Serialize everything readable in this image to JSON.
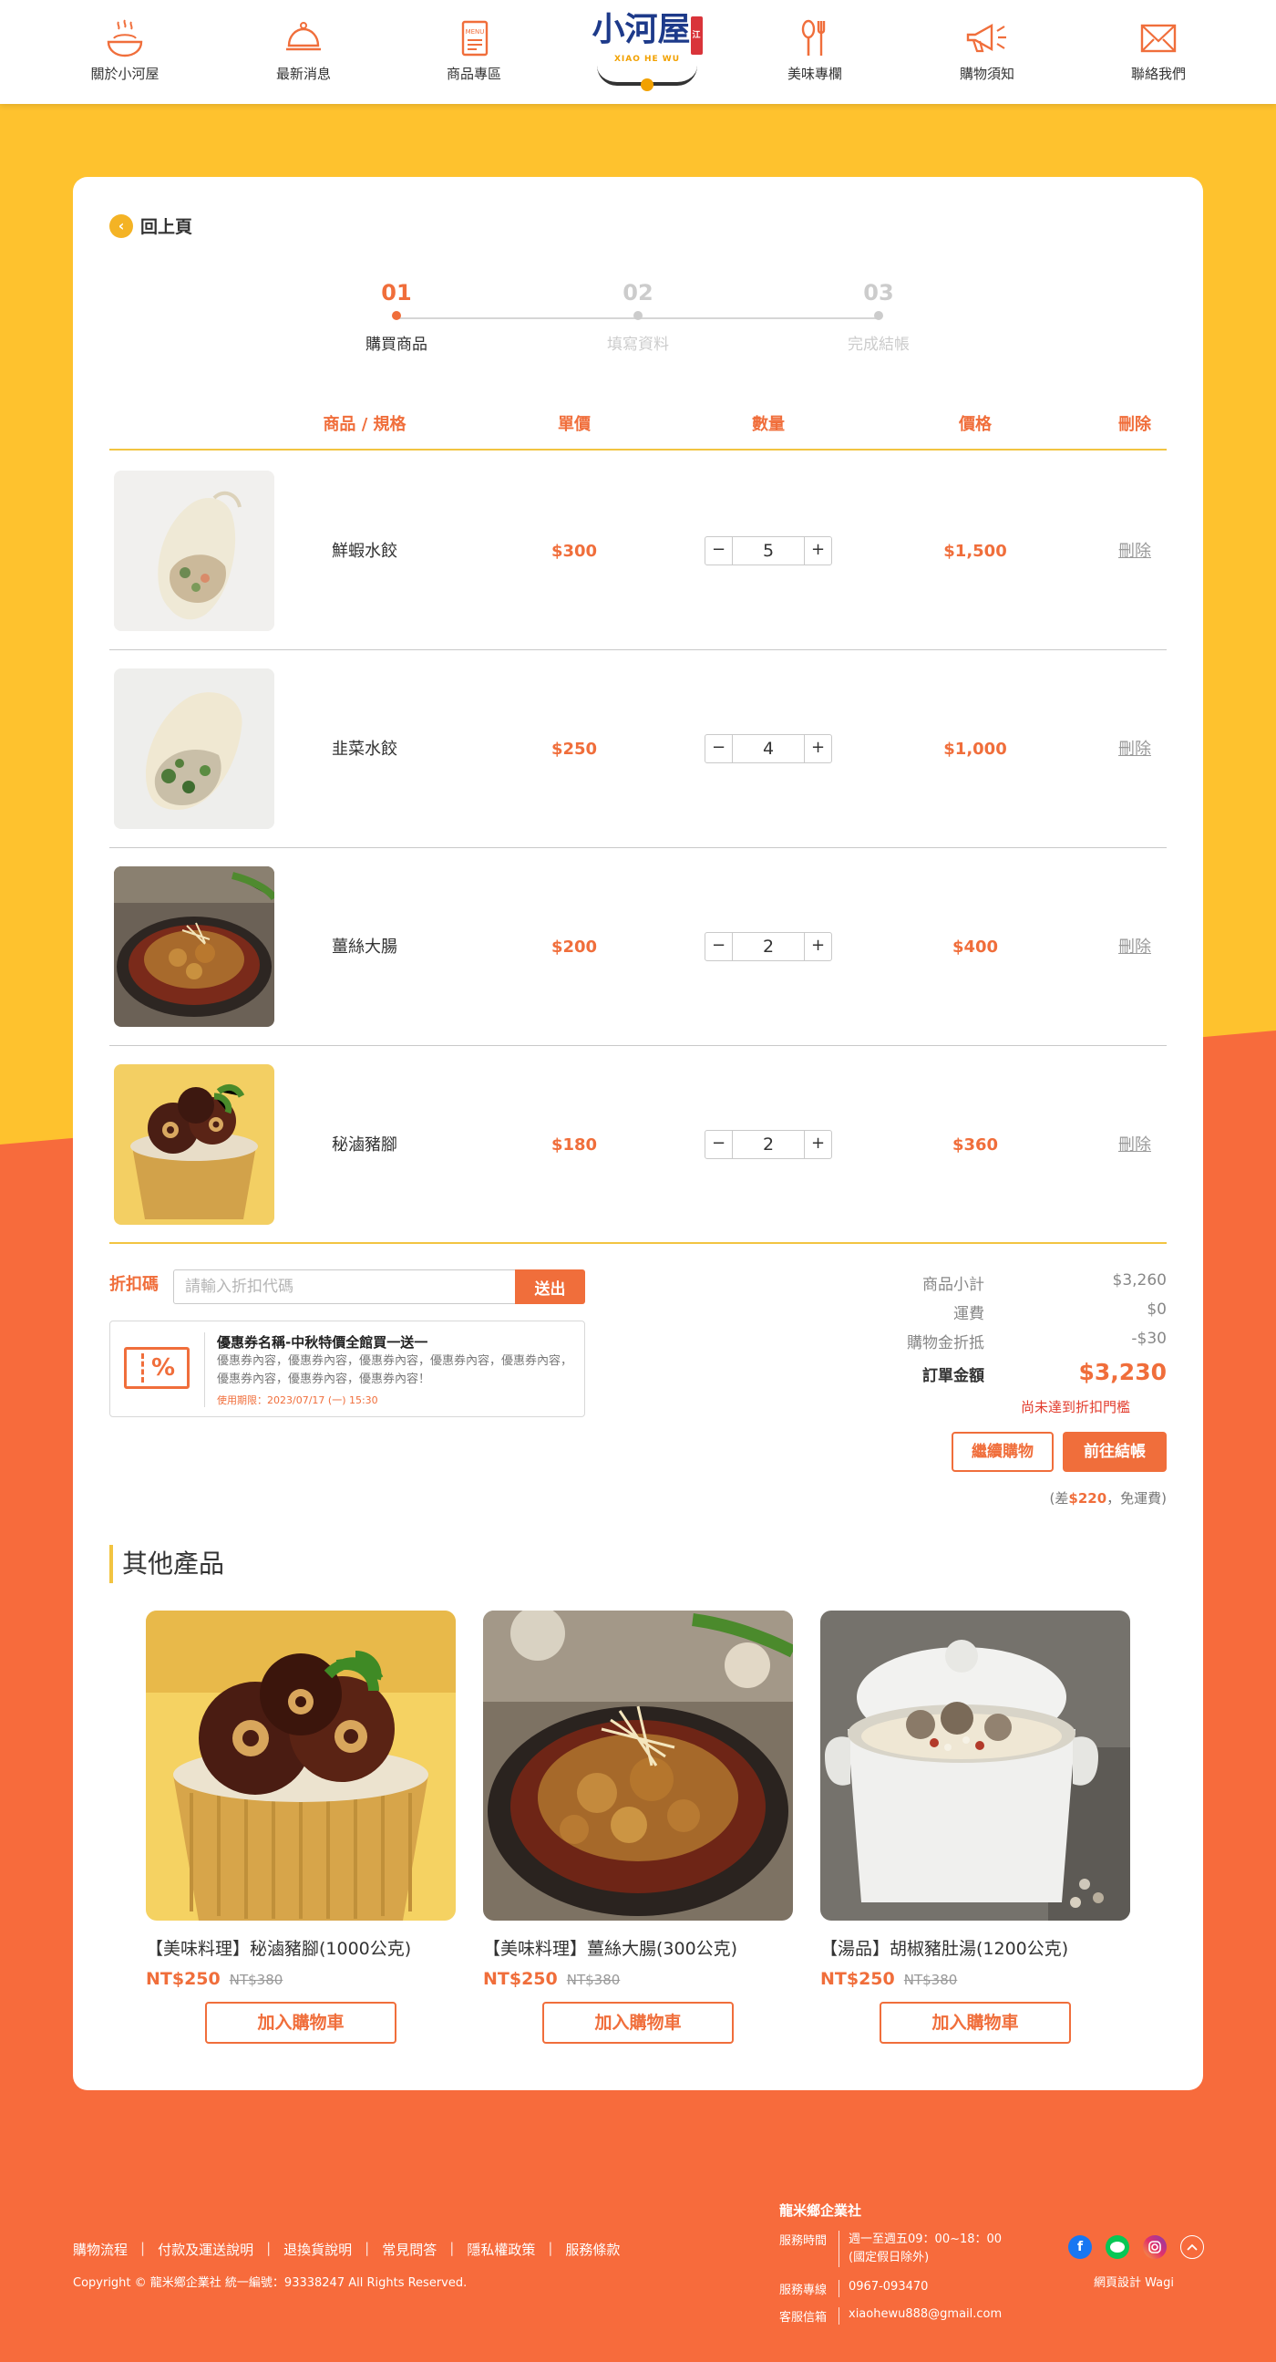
{
  "nav": {
    "left": [
      "關於小河屋",
      "最新消息",
      "商品專區"
    ],
    "right": [
      "美味專欄",
      "購物須知",
      "聯絡我們"
    ]
  },
  "logo": {
    "main": "小河屋",
    "sub": "XIAO HE WU",
    "badge": "江"
  },
  "back_label": "回上頁",
  "steps": [
    {
      "num": "01",
      "label": "購買商品"
    },
    {
      "num": "02",
      "label": "填寫資料"
    },
    {
      "num": "03",
      "label": "完成結帳"
    }
  ],
  "table_headers": {
    "product": "商品 / 規格",
    "unit": "單價",
    "qty": "數量",
    "price": "價格",
    "delete": "刪除"
  },
  "cart": [
    {
      "name": "鮮蝦水餃",
      "unit": "$300",
      "qty": "5",
      "total": "$1,500",
      "delete": "刪除"
    },
    {
      "name": "韭菜水餃",
      "unit": "$250",
      "qty": "4",
      "total": "$1,000",
      "delete": "刪除"
    },
    {
      "name": "薑絲大腸",
      "unit": "$200",
      "qty": "2",
      "total": "$400",
      "delete": "刪除"
    },
    {
      "name": "秘滷豬腳",
      "unit": "$180",
      "qty": "2",
      "total": "$360",
      "delete": "刪除"
    }
  ],
  "qty_minus": "−",
  "qty_plus": "+",
  "coupon": {
    "label": "折扣碼",
    "placeholder": "請輸入折扣代碼",
    "submit": "送出",
    "icon_text": "%",
    "title": "優惠券名稱-中秋特價全館買一送一",
    "desc": "優惠券內容，優惠券內容，優惠券內容，優惠券內容，優惠券內容，優惠券內容，優惠券內容，優惠券內容！",
    "expiry": "使用期限：2023/07/17 (一) 15:30"
  },
  "summary": {
    "subtotal_label": "商品小計",
    "subtotal": "$3,260",
    "shipping_label": "運費",
    "shipping": "$0",
    "discount_label": "購物金折抵",
    "discount": "-$30",
    "total_label": "訂單金額",
    "total": "$3,230",
    "threshold": "尚未達到折扣門檻",
    "continue": "繼續購物",
    "checkout": "前往結帳",
    "freeship_pre": "(差",
    "freeship_amount": "$220",
    "freeship_post": "，免運費)"
  },
  "other": {
    "title": "其他產品",
    "items": [
      {
        "name": "【美味料理】秘滷豬腳(1000公克)",
        "price": "NT$250",
        "old": "NT$380",
        "button": "加入購物車"
      },
      {
        "name": "【美味料理】薑絲大腸(300公克)",
        "price": "NT$250",
        "old": "NT$380",
        "button": "加入購物車"
      },
      {
        "name": "【湯品】胡椒豬肚湯(1200公克)",
        "price": "NT$250",
        "old": "NT$380",
        "button": "加入購物車"
      }
    ]
  },
  "footer": {
    "links": [
      "購物流程",
      "付款及運送說明",
      "退換貨說明",
      "常見問答",
      "隱私權政策",
      "服務條款"
    ],
    "copyright": "Copyright © 龍米鄉企業社 統一編號：93338247 All Rights Reserved.",
    "company": "龍米鄉企業社",
    "hours_label": "服務時間",
    "hours": "週一至週五09：00~18：00",
    "hours_note": "(國定假日除外)",
    "phone_label": "服務專線",
    "phone": "0967-093470",
    "email_label": "客服信箱",
    "email": "xiaohewu888@gmail.com",
    "designer": "網頁設計 Wagi"
  },
  "colors": {
    "accent": "#f06e3b",
    "yellow": "#fec22e",
    "orange_bg": "#f76b3c"
  },
  "icons": [
    "bowl-icon",
    "cloche-icon",
    "menu-icon",
    "fork-spoon-icon",
    "megaphone-icon",
    "mail-icon",
    "facebook-icon",
    "line-icon",
    "instagram-icon",
    "scroll-top-icon"
  ]
}
